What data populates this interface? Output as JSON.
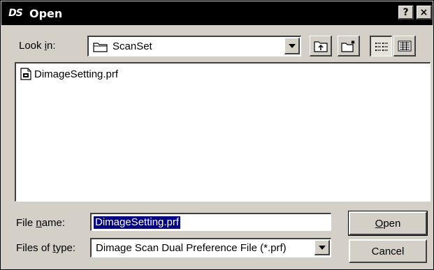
{
  "window": {
    "title": "Open",
    "app_icon_text": "DS",
    "help_glyph": "?",
    "close_glyph": "×"
  },
  "lookin": {
    "label_prefix": "Look ",
    "label_accel": "i",
    "label_suffix": "n:",
    "current_folder": "ScanSet"
  },
  "toolbar": {
    "buttons": [
      "up-one-level",
      "create-new-folder",
      "list-view",
      "details-view"
    ],
    "active": "list-view"
  },
  "file_list": {
    "items": [
      {
        "name": "DimageSetting.prf",
        "icon": "document-icon"
      }
    ]
  },
  "filename": {
    "label_prefix": "File ",
    "label_accel": "n",
    "label_suffix": "ame:",
    "value": "DimageSetting.prf"
  },
  "filetype": {
    "label_prefix": "Files of ",
    "label_accel": "t",
    "label_suffix": "ype:",
    "selected": "Dimage Scan Dual Preference File (*.prf)"
  },
  "buttons": {
    "open_accel": "O",
    "open_rest": "pen",
    "cancel": "Cancel"
  },
  "colors": {
    "face": "#d4d0c8",
    "titlebar": "#000000",
    "selection": "#000080"
  }
}
